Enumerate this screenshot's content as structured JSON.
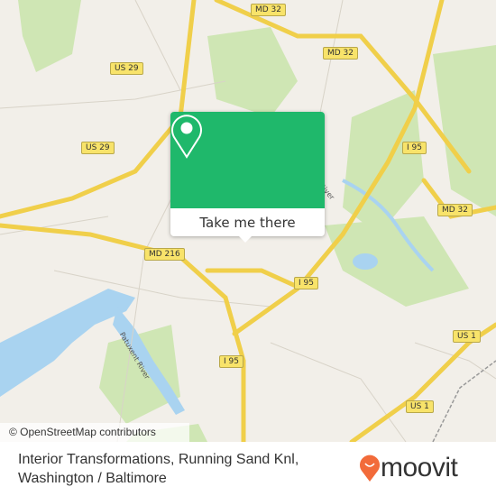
{
  "map": {
    "road_labels": [
      "MD 32",
      "MD 32",
      "US 29",
      "US 29",
      "I 95",
      "MD 32",
      "MD 216",
      "I 95",
      "US 1",
      "I 95",
      "US 1"
    ],
    "river_labels": [
      "Patuxent River",
      "River"
    ],
    "attribution": "© OpenStreetMap contributors",
    "colors": {
      "land": "#f2efe9",
      "park": "#cfe6b4",
      "water": "#a9d3f0",
      "highway": "#f8e36a",
      "popup": "#1fb86b",
      "brand": "#f26b3a"
    }
  },
  "popup": {
    "icon": "map-pin-icon",
    "button_label": "Take me there"
  },
  "footer": {
    "place_line1": "Interior Transformations, Running Sand Knl,",
    "place_line2": "Washington / Baltimore",
    "logo_text": "moovit"
  }
}
